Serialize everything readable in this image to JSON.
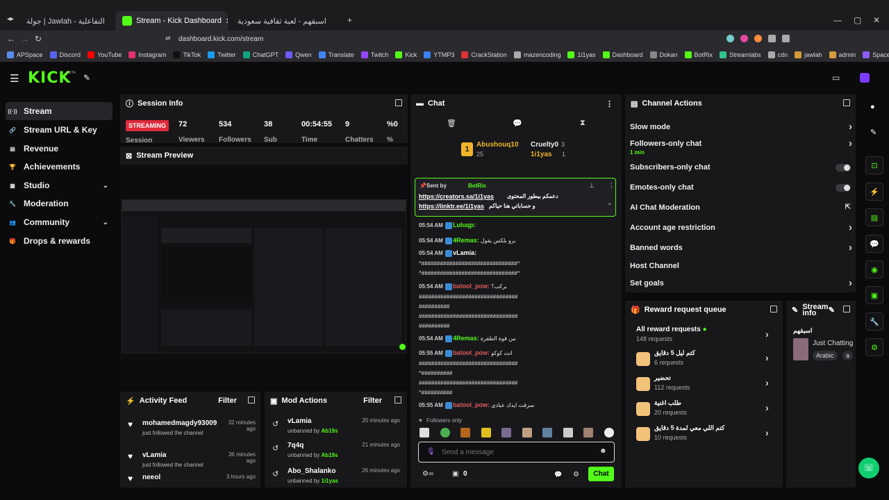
{
  "browser": {
    "tabs": [
      {
        "title": "جولة | Jawlah - منصة الألعاب التفاعلية"
      },
      {
        "title": "Stream - Kick Dashboard"
      },
      {
        "title": "اسبقهم - لعبة ثقافية سعودية"
      }
    ],
    "url": "dashboard.kick.com/stream",
    "bookmarks": [
      "APSpace",
      "Discord",
      "YouTube",
      "Instagram",
      "TikTok",
      "Twitter",
      "ChatGPT",
      "Qwen",
      "Translate",
      "Twitch",
      "Kick",
      "YTMP3",
      "CrackStation",
      "mazencoding",
      "1i1yas",
      "Dashboard",
      "Dokan",
      "BotRix",
      "Streamlabs",
      "cdn",
      "jawlah",
      "admin",
      "Spacemail"
    ],
    "bookmark_colors": [
      "#5a8dee",
      "#5865f2",
      "#ff0000",
      "#e1306c",
      "#111111",
      "#1d9bf0",
      "#10a37f",
      "#6b5bff",
      "#4285f4",
      "#9146ff",
      "#53fc18",
      "#3b82f6",
      "#d33",
      "#aaa",
      "#53fc18",
      "#53fc18",
      "#888",
      "#53fc18",
      "#31c48d",
      "#aaa",
      "#d49a3a",
      "#d49a3a",
      "#8b5cf6"
    ]
  },
  "app": {
    "logo": "KICK",
    "logo_beta": "BETA",
    "nav": [
      {
        "label": "Stream",
        "icon": "signal-icon",
        "glyph": "((·))"
      },
      {
        "label": "Stream URL & Key",
        "icon": "link-icon",
        "glyph": "🔗"
      },
      {
        "label": "Revenue",
        "icon": "revenue-icon",
        "glyph": "▤"
      },
      {
        "label": "Achievements",
        "icon": "trophy-icon",
        "glyph": "🏆"
      },
      {
        "label": "Studio",
        "icon": "studio-icon",
        "glyph": "▦"
      },
      {
        "label": "Moderation",
        "icon": "wrench-icon",
        "glyph": "🔧"
      },
      {
        "label": "Community",
        "icon": "community-icon",
        "glyph": "👥"
      },
      {
        "label": "Drops & rewards",
        "icon": "gift-icon",
        "glyph": "🎁"
      }
    ],
    "session": {
      "title": "Session Info",
      "status": "STREAMING",
      "status_label": "Session",
      "viewers": "72",
      "followers": "534",
      "sub": "38",
      "time": "00:54:55",
      "chatters": "9",
      "percent": "%0",
      "labels": [
        "Viewers",
        "Followers",
        "Sub",
        "Time",
        "Chatters",
        "%"
      ]
    },
    "preview": {
      "title": "Stream Preview"
    },
    "activity": {
      "title": "Activity Feed",
      "filter": "Filter",
      "items": [
        {
          "name": "mohamedmagdy93009",
          "sub": "just followed the channel",
          "time": "32 minutes ago"
        },
        {
          "name": "vLamia",
          "sub": "just followed the channel",
          "time": "36 minutes ago"
        },
        {
          "name": "neeol",
          "sub": "",
          "time": "3 hours ago"
        }
      ]
    },
    "mod_actions": {
      "title": "Mod Actions",
      "filter": "Filter",
      "items": [
        {
          "name": "vLamia",
          "sub_prefix": "unbanned by",
          "by": "Ab19s",
          "time": "20 minutes ago"
        },
        {
          "name": "7q4q",
          "sub_prefix": "unbanned by",
          "by": "Ab19s",
          "time": "21 minutes ago"
        },
        {
          "name": "Abo_Shalanko",
          "sub_prefix": "unbanned by",
          "by": "1i1yas",
          "time": "26 minutes ago"
        }
      ]
    },
    "chat": {
      "title": "Chat",
      "top": [
        {
          "name": "Abushouq10",
          "count": "25"
        },
        {
          "name": "Cruelty0",
          "count": "3"
        },
        {
          "name": "1i1yas",
          "count": "1"
        }
      ],
      "pinned": {
        "sent_by_label": "Sent by",
        "sender": "BotRix",
        "text_ar": "دعمكم بيطور المحتوى",
        "link1": "https://creators.sa/1i1yas",
        "text_ar2": "و حساباتي هنا حياكم",
        "link2": "https://linktr.ee/1i1yas"
      },
      "messages": [
        {
          "time": "05:54 AM",
          "user": "Luluqp:",
          "text": "",
          "color": "#53fc18"
        },
        {
          "time": "05:54 AM",
          "user": "4Remas:",
          "text": "برو بلكس يقول",
          "color": "#53fc18"
        },
        {
          "time": "05:54 AM",
          "user": "vLamia:",
          "text": "",
          "color": "#ffffff"
        },
        {
          "time": "",
          "user": "",
          "text": "^###############################^",
          "color": ""
        },
        {
          "time": "",
          "user": "",
          "text": "^###############################^",
          "color": ""
        },
        {
          "time": "05:54 AM",
          "user": "batool_pow:",
          "text": "بركب؟",
          "color": "#e05a5a"
        },
        {
          "time": "",
          "user": "",
          "text": "################################",
          "color": ""
        },
        {
          "time": "",
          "user": "",
          "text": "##########",
          "color": ""
        },
        {
          "time": "",
          "user": "",
          "text": "################################",
          "color": ""
        },
        {
          "time": "",
          "user": "",
          "text": "##########",
          "color": ""
        },
        {
          "time": "05:54 AM",
          "user": "4Remas:",
          "text": "من قوة الطفرة",
          "color": "#53fc18"
        },
        {
          "time": "05:55 AM",
          "user": "batool_pow:",
          "text": "انت كوكو",
          "color": "#e05a5a"
        },
        {
          "time": "",
          "user": "",
          "text": "################################",
          "color": ""
        },
        {
          "time": "",
          "user": "",
          "text": "^##########",
          "color": ""
        },
        {
          "time": "",
          "user": "",
          "text": "################################",
          "color": ""
        },
        {
          "time": "",
          "user": "",
          "text": "^##########",
          "color": ""
        },
        {
          "time": "05:55 AM",
          "user": "batool_pow:",
          "text": "سرقت ايدك عبادي",
          "color": "#e05a5a"
        }
      ],
      "followers_only": "Followers only",
      "placeholder": "Send a message",
      "chat_button": "Chat",
      "count": "0"
    },
    "channel_actions": {
      "title": "Channel Actions",
      "items": [
        {
          "label": "Slow mode",
          "kind": "chevron"
        },
        {
          "label": "Followers-only chat",
          "sub": "1 min",
          "kind": "chevron"
        },
        {
          "label": "Subscribers-only chat",
          "kind": "toggle"
        },
        {
          "label": "Emotes-only chat",
          "kind": "toggle"
        },
        {
          "label": "AI Chat Moderation",
          "kind": "external"
        },
        {
          "label": "Account age restriction",
          "kind": "chevron"
        },
        {
          "label": "Banned words",
          "kind": "chevron"
        },
        {
          "label": "Host Channel",
          "kind": "none"
        },
        {
          "label": "Set goals",
          "kind": "chevron"
        }
      ]
    },
    "rewards": {
      "title": "Reward request queue",
      "all": {
        "label": "All reward requests",
        "sub": "148 requests"
      },
      "items": [
        {
          "label": "كتم ليل 5 دقايق",
          "sub": "6 requests"
        },
        {
          "label": "تحضير",
          "sub": "112 requests"
        },
        {
          "label": "طلب اغنية",
          "sub": "20 requests"
        },
        {
          "label": "كتم اللي معي لمدة 5 دقايق",
          "sub": "10 requests"
        }
      ]
    },
    "stream_info": {
      "title": "Stream info",
      "game": "اسبقهم",
      "category": "Just Chatting",
      "tags": [
        "Arabic",
        "a"
      ]
    }
  }
}
